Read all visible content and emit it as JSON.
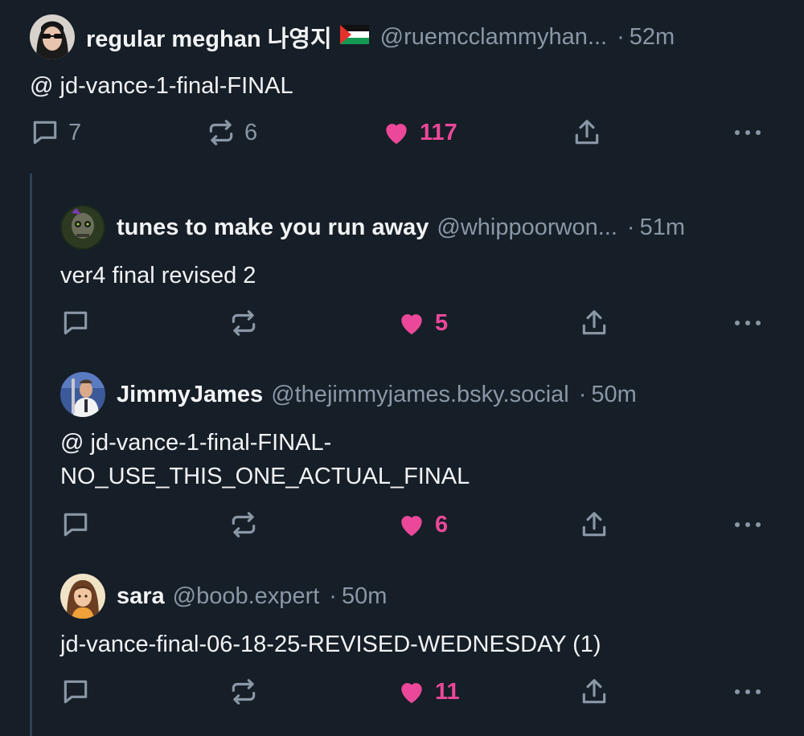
{
  "colors": {
    "background": "#161e27",
    "text": "#f1f3f5",
    "muted": "#8a97a6",
    "like": "#ec4899",
    "thread_line": "#2e4052"
  },
  "posts": [
    {
      "name": "regular meghan 나영지",
      "handle": "@ruemcclammyhan...",
      "time": "52m",
      "text": "@ jd-vance-1-final-FINAL",
      "reply_count": "7",
      "repost_count": "6",
      "like_count": "117",
      "has_flag": true
    },
    {
      "name": "tunes to make you run away",
      "handle": "@whippoorwon...",
      "time": "51m",
      "text": "ver4 final revised 2",
      "reply_count": "",
      "repost_count": "",
      "like_count": "5"
    },
    {
      "name": "JimmyJames",
      "handle": "@thejimmyjames.bsky.social",
      "time": "50m",
      "text_line1": "@ jd-vance-1-final-FINAL-",
      "text_line2": "NO_USE_THIS_ONE_ACTUAL_FINAL",
      "reply_count": "",
      "repost_count": "",
      "like_count": "6"
    },
    {
      "name": "sara",
      "handle": "@boob.expert",
      "time": "50m",
      "text": "jd-vance-final-06-18-25-REVISED-WEDNESDAY (1)",
      "reply_count": "",
      "repost_count": "",
      "like_count": "11"
    }
  ],
  "time_separator": "·",
  "icons": {
    "reply": "reply-icon",
    "repost": "repost-icon",
    "like": "heart-icon",
    "share": "share-icon",
    "more": "more-icon",
    "flag": "palestine-flag-icon"
  }
}
